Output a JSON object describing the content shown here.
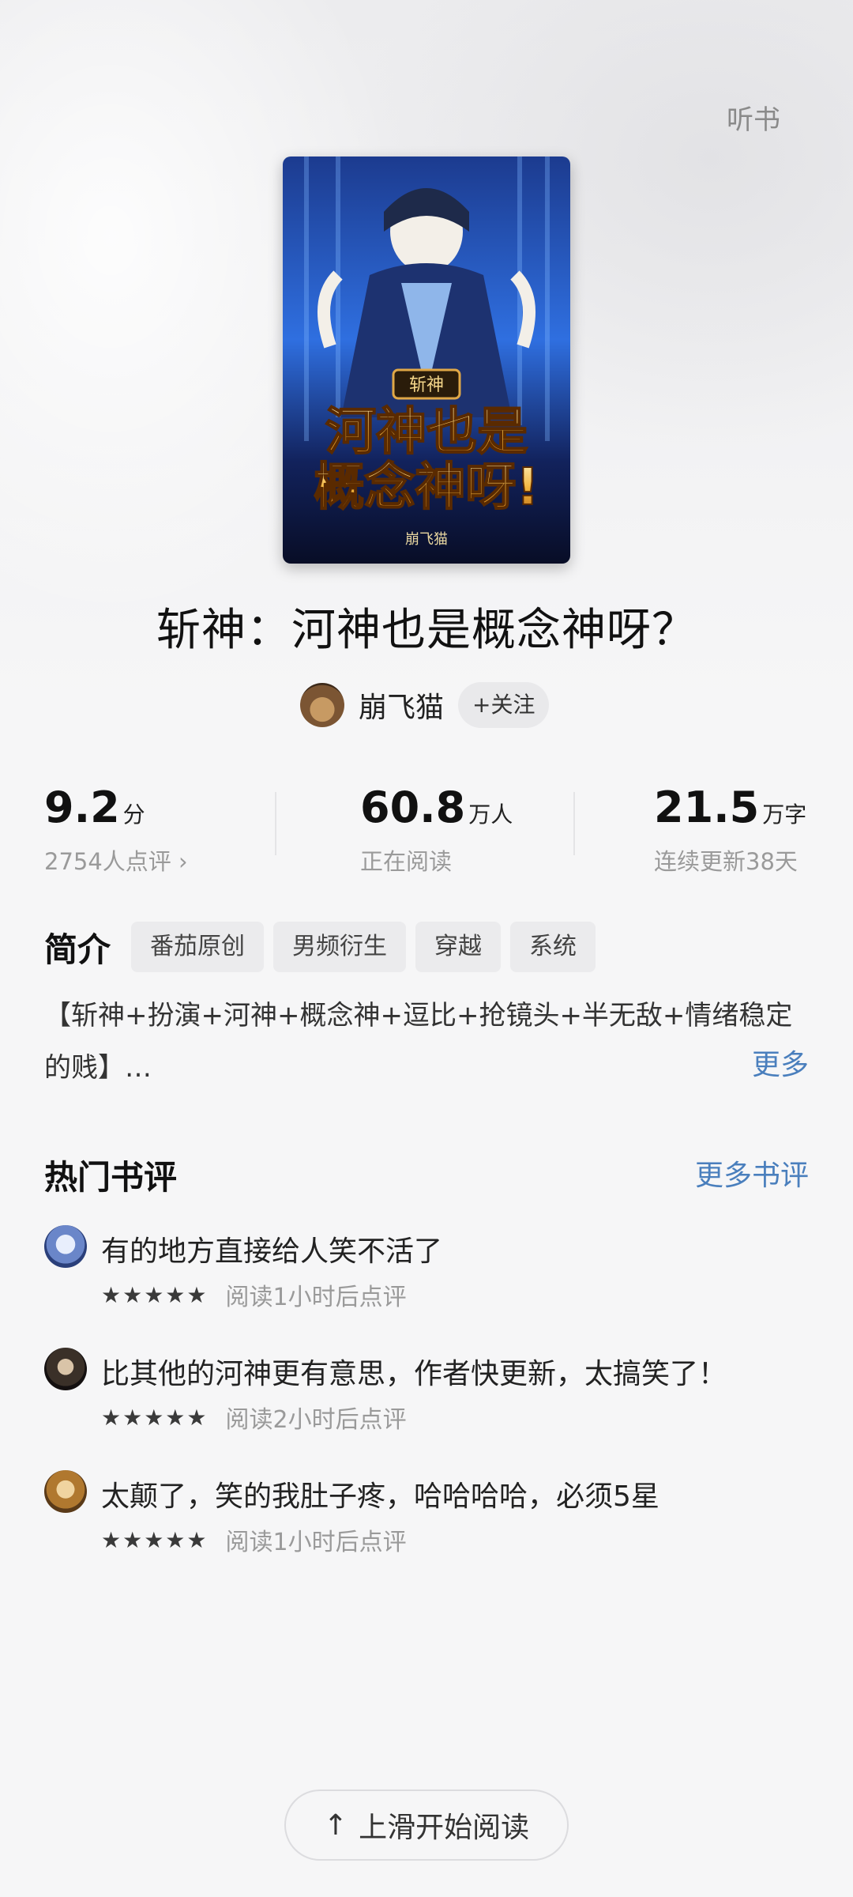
{
  "header": {
    "listen_label": "听书"
  },
  "book": {
    "title": "斩神：河神也是概念神呀？",
    "cover_text_main": "河神也是概念神呀!",
    "cover_text_badge": "斩神",
    "cover_author": "崩飞猫"
  },
  "author": {
    "name": "崩飞猫",
    "follow_label": "+关注"
  },
  "stats": [
    {
      "value": "9.2",
      "unit": "分",
      "sub": "2754人点评 ›"
    },
    {
      "value": "60.8",
      "unit": "万人",
      "sub": "正在阅读"
    },
    {
      "value": "21.5",
      "unit": "万字",
      "sub": "连续更新38天"
    }
  ],
  "intro": {
    "title": "简介",
    "tags": [
      "番茄原创",
      "男频衍生",
      "穿越",
      "系统"
    ],
    "text": "【斩神+扮演+河神+概念神+逗比+抢镜头+半无敌+情绪稳定的贱】…",
    "more_label": "更多"
  },
  "reviews": {
    "title": "热门书评",
    "more_label": "更多书评",
    "items": [
      {
        "text": "有的地方直接给人笑不活了",
        "stars": "★★★★★",
        "note": "阅读1小时后点评"
      },
      {
        "text": "比其他的河神更有意思，作者快更新，太搞笑了！",
        "stars": "★★★★★",
        "note": "阅读2小时后点评"
      },
      {
        "text": "太颠了，笑的我肚子疼，哈哈哈哈，必须5星",
        "stars": "★★★★★",
        "note": "阅读1小时后点评"
      }
    ]
  },
  "footer": {
    "start_label": "上滑开始阅读"
  }
}
